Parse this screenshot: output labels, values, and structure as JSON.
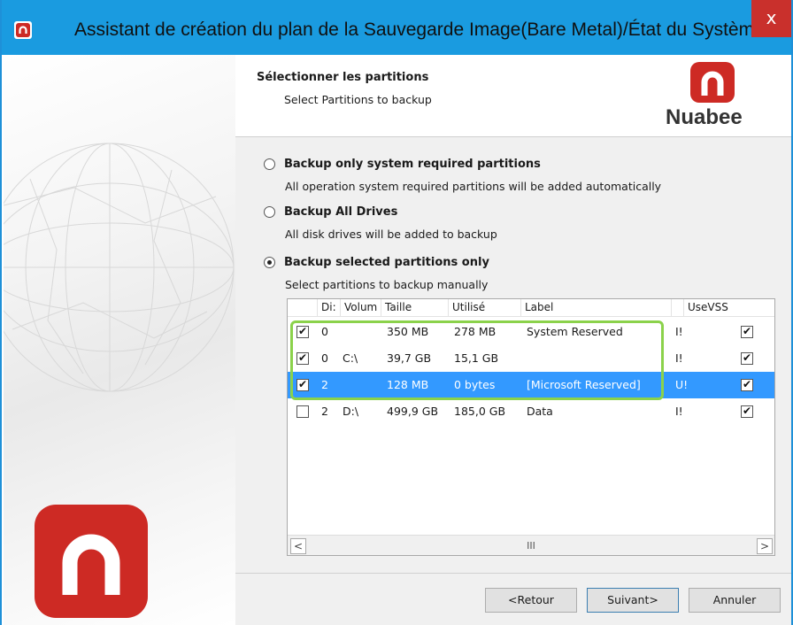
{
  "window": {
    "title": "Assistant de création du plan de la Sauvegarde Image(Bare Metal)/État du Système",
    "close_glyph": "x"
  },
  "header": {
    "title": "Sélectionner les partitions",
    "subtitle": "Select Partitions to backup",
    "brand_name": "Nuabee",
    "brand_color": "#cd2a24"
  },
  "options": [
    {
      "label": "Backup only system required partitions",
      "desc": "All operation system required partitions will be added automatically",
      "checked": false
    },
    {
      "label": "Backup All Drives",
      "desc": "All disk drives will be added to backup",
      "checked": false
    },
    {
      "label": "Backup selected partitions only",
      "desc": "Select partitions to backup manually",
      "checked": true
    }
  ],
  "table": {
    "columns": [
      "Di:",
      "Volum",
      "Taille",
      "Utilisé",
      "Label",
      "",
      "UseVSS"
    ],
    "rows": [
      {
        "checked": true,
        "disk": "0",
        "volume": "",
        "size": "350 MB",
        "used": "278 MB",
        "label": "System Reserved",
        "fs": "I!",
        "usevss": true,
        "selected": false
      },
      {
        "checked": true,
        "disk": "0",
        "volume": "C:\\",
        "size": "39,7 GB",
        "used": "15,1 GB",
        "label": "",
        "fs": "I!",
        "usevss": true,
        "selected": false
      },
      {
        "checked": true,
        "disk": "2",
        "volume": "",
        "size": "128 MB",
        "used": "0 bytes",
        "label": "[Microsoft Reserved]",
        "fs": "U!",
        "usevss": true,
        "selected": true
      },
      {
        "checked": false,
        "disk": "2",
        "volume": "D:\\",
        "size": "499,9 GB",
        "used": "185,0 GB",
        "label": "Data",
        "fs": "I!",
        "usevss": true,
        "selected": false
      }
    ],
    "scroll_left": "<",
    "scroll_right": ">",
    "scroll_thumb": "III"
  },
  "buttons": {
    "back": "<Retour",
    "next": "Suivant>",
    "cancel": "Annuler"
  },
  "colors": {
    "titlebar": "#1a9be0",
    "selection": "#3399ff",
    "highlight": "#8bd24b"
  }
}
